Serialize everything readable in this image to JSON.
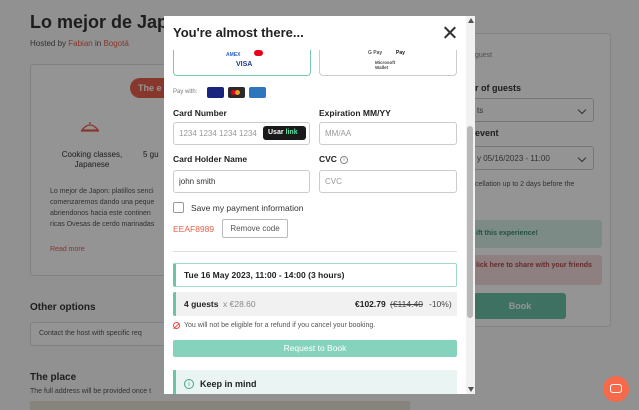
{
  "background": {
    "title": "Lo mejor de Japon",
    "hosted_prefix": "Hosted by",
    "host_name": "Fabian",
    "in_text": "in",
    "city": "Bogotá",
    "pill_text": "The e",
    "cooking_label": "Cooking classes, Japanese",
    "five_label": "5 gu",
    "description": "Lo mejor de Japon: platillos senci comenzaremos dando una peque abriendonos hacia este continen ricas Ovesas de cerdo marinadas",
    "read_more": "Read more",
    "other_options": "Other options",
    "contact_host": "Contact the host with specific req",
    "the_place": "The place",
    "address_note": "The full address will be provided once t",
    "sidebar": {
      "guest_top": "guest",
      "num_guests_label": "r of guests",
      "guests_select": "ts",
      "event_label": "event",
      "event_select": "y 05/16/2023 - 11:00",
      "cancel_text": "cellation up to 2 days before the",
      "gift_text": "ift this experience!",
      "share_text": "lick here to share with your friends",
      "book_label": "Book"
    }
  },
  "modal": {
    "title": "You're almost there...",
    "payment_methods": {
      "brand_visa": "VISA",
      "brand_amex": "AMEX",
      "brand_pay": "Pay",
      "brand_gpay": "G Pay",
      "brand_microsoft": "Microsoft Wallet"
    },
    "pay_with_label": "Pay with:",
    "card_number_label": "Card Number",
    "card_number_placeholder": "1234 1234 1234 1234",
    "link_button": {
      "use": "Usar",
      "link": "link"
    },
    "expiration_label": "Expiration MM/YY",
    "expiration_placeholder": "MM/AA",
    "holder_label": "Card Holder Name",
    "holder_value": "john smith",
    "cvc_label": "CVC",
    "cvc_placeholder": "CVC",
    "save_label": "Save my payment information",
    "promo_code": "EEAF8989",
    "remove_code": "Remove code",
    "date_time": "Tue 16 May 2023, 11:00 - 14:00 (3 hours)",
    "guests_count": "4 guests",
    "guests_price": "x €28.60",
    "total_price": "€102.79",
    "old_price": "(€114.40",
    "discount": "-10%)",
    "refund_notice": "You will not be eligible for a refund if you cancel your booking.",
    "request_button": "Request to Book",
    "keep_in_mind": "Keep in mind"
  },
  "colors": {
    "accent": "#6cc3a9",
    "brand_orange": "#e8604c",
    "error_red": "#e44444"
  },
  "icons": {
    "close": "close-icon",
    "info": "info-icon",
    "refund": "no-entry-icon",
    "chat": "chat-icon"
  }
}
